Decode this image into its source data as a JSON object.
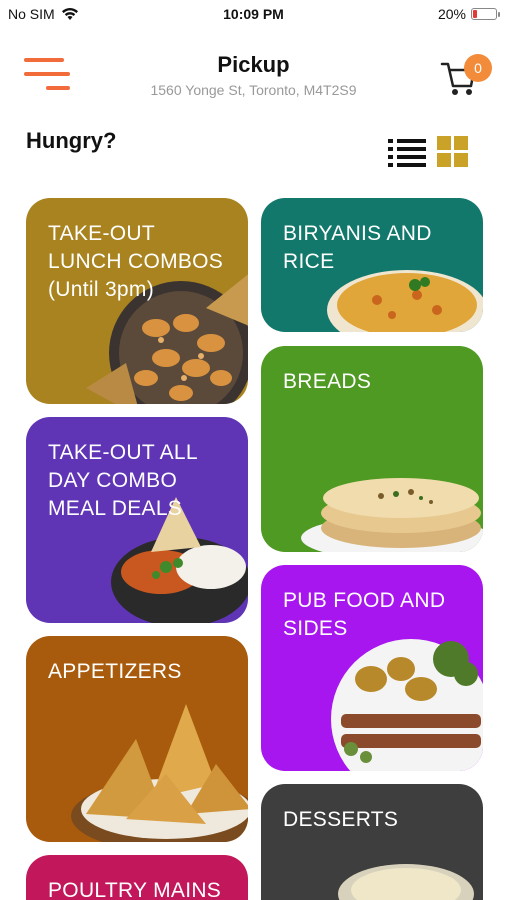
{
  "status_bar": {
    "carrier": "No SIM",
    "time": "10:09 PM",
    "battery_pct": "20%",
    "battery_level": 0.2
  },
  "header": {
    "title": "Pickup",
    "address": "1560 Yonge St, Toronto, M4T2S9",
    "cart_count": "0"
  },
  "section": {
    "title": "Hungry?"
  },
  "categories": [
    {
      "label": "TAKE-OUT LUNCH COMBOS (Until 3pm)",
      "color": "#a8831f",
      "image": "shrimp-dish-image"
    },
    {
      "label": "BIRYANIS AND RICE",
      "color": "#12786b",
      "image": "biryani-image"
    },
    {
      "label": "BREADS",
      "color": "#4e9a22",
      "image": "naan-bread-image"
    },
    {
      "label": "TAKE-OUT ALL DAY COMBO MEAL DEALS",
      "color": "#5f35b5",
      "image": "curry-rice-bowl-image"
    },
    {
      "label": "PUB FOOD AND SIDES",
      "color": "#a816ef",
      "image": "kebab-platter-image"
    },
    {
      "label": "APPETIZERS",
      "color": "#a85a0d",
      "image": "samosa-image"
    },
    {
      "label": "DESSERTS",
      "color": "#3e3e3e",
      "image": "dessert-bowl-image"
    },
    {
      "label": "POULTRY MAINS",
      "color": "#c2185b",
      "image": ""
    }
  ],
  "colors": {
    "accent": "#f26b3a",
    "badge": "#f28c3a",
    "grid_icon": "#c9a227"
  }
}
